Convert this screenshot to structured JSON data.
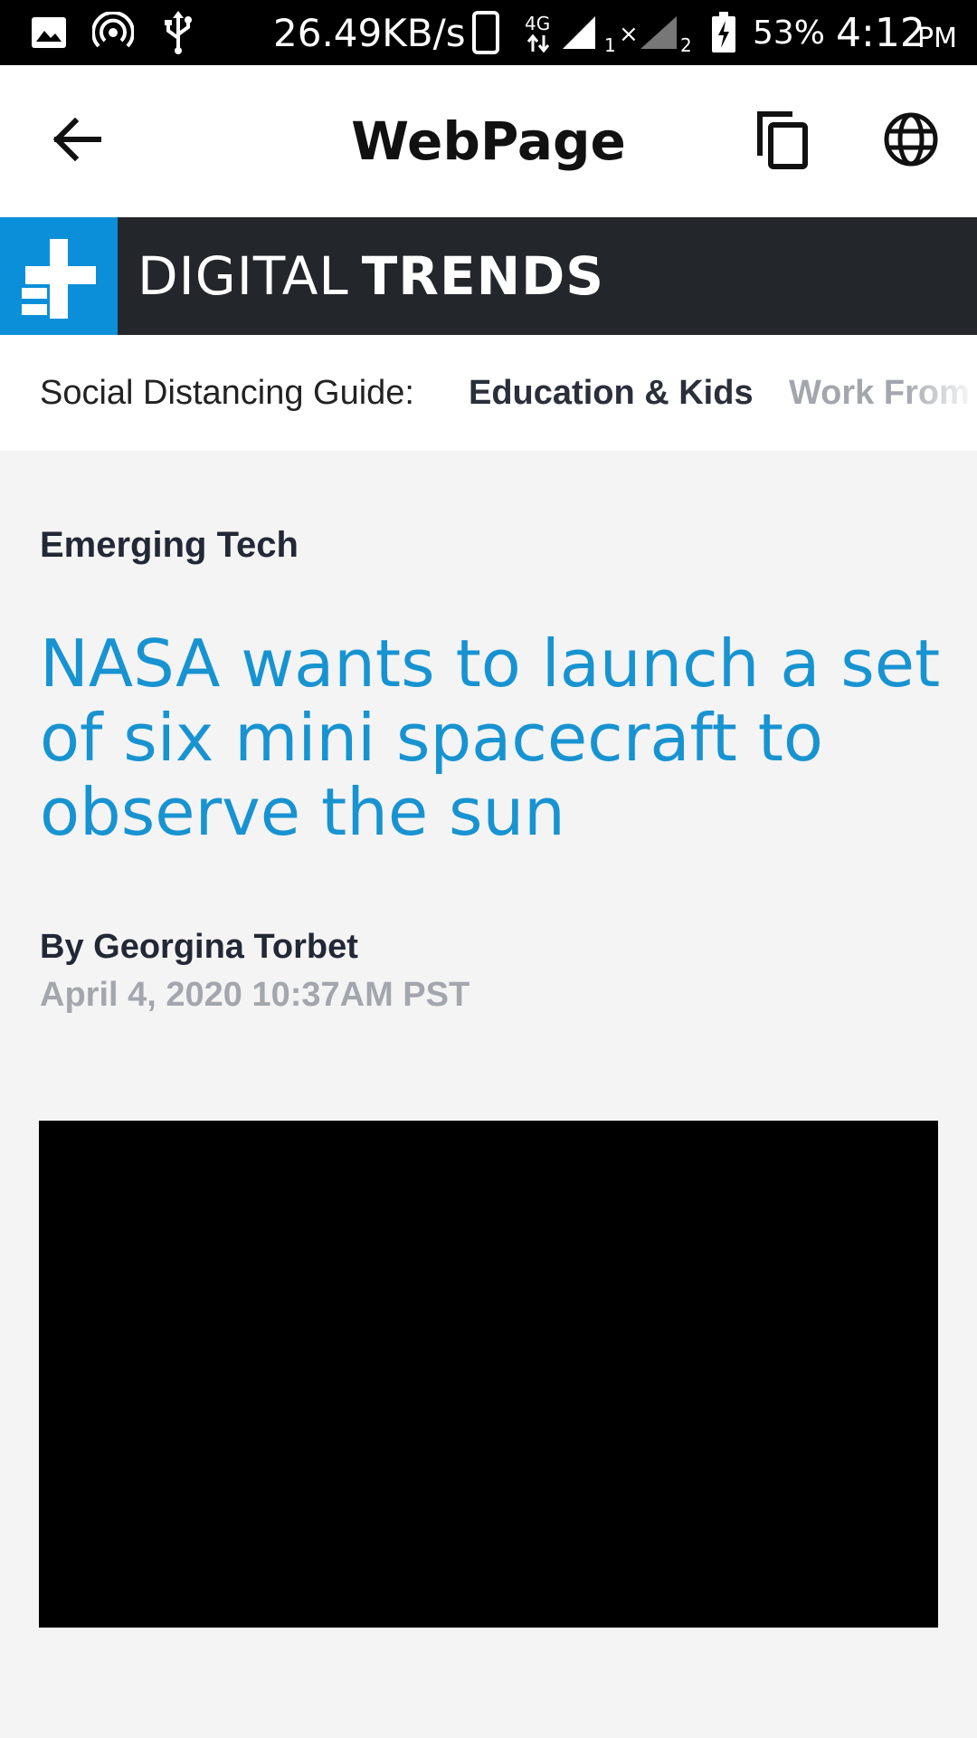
{
  "status_bar": {
    "network_speed": "26.49KB/s",
    "network_type": "4G",
    "sim1_label": "1",
    "sim2_label": "2",
    "battery": "53%",
    "time": "4:12",
    "ampm": "PM",
    "icons": [
      "image-icon",
      "hotspot-icon",
      "usb-icon",
      "phone-icon",
      "signal-icon",
      "signal-icon",
      "battery-charging-icon"
    ]
  },
  "app_bar": {
    "title": "WebPage",
    "back_icon": "arrow-left-icon",
    "copy_icon": "copy-icon",
    "globe_icon": "globe-icon"
  },
  "site": {
    "name_part1": "DIGITAL",
    "name_part2": "TRENDS",
    "brand_color": "#0b8fd8",
    "header_color": "#23272c"
  },
  "guide": {
    "label": "Social Distancing Guide:",
    "links": [
      "Education & Kids",
      "Work From Home"
    ]
  },
  "article": {
    "category": "Emerging Tech",
    "title": "NASA wants to launch a set of six mini spacecraft to observe the sun",
    "author": "By Georgina Torbet",
    "date": "April 4, 2020 10:37AM PST",
    "title_color": "#1893d1"
  }
}
